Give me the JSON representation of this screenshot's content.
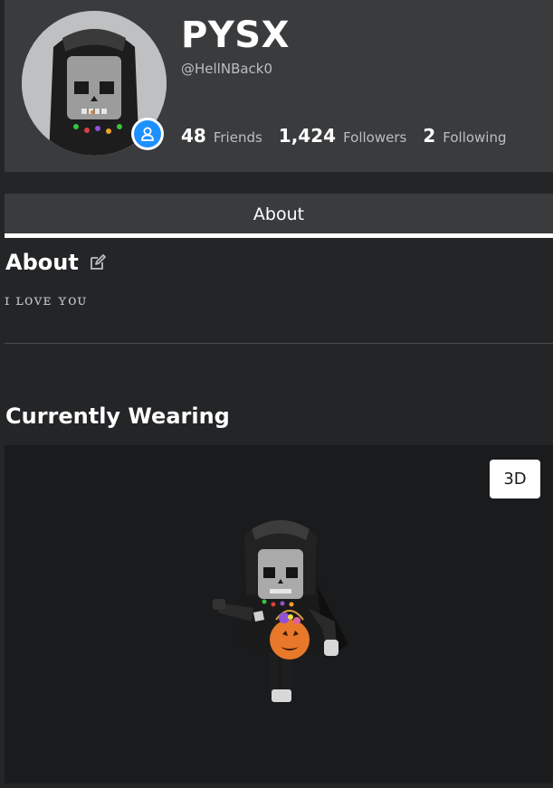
{
  "profile": {
    "display_name": "PYSX",
    "username": "@HellNBack0",
    "stats": [
      {
        "count": "48",
        "label": "Friends"
      },
      {
        "count": "1,424",
        "label": "Followers"
      },
      {
        "count": "2",
        "label": "Following"
      }
    ]
  },
  "tabs": {
    "about_label": "About"
  },
  "about": {
    "title": "About",
    "description": "ɪ ʟᴏᴠᴇ ʏᴏᴜ"
  },
  "wearing": {
    "title": "Currently Wearing",
    "button_3d": "3D"
  },
  "colors": {
    "background": "#232527",
    "panel": "#393b3d",
    "viewer": "#191b1d",
    "presence": "#1e90ff"
  }
}
